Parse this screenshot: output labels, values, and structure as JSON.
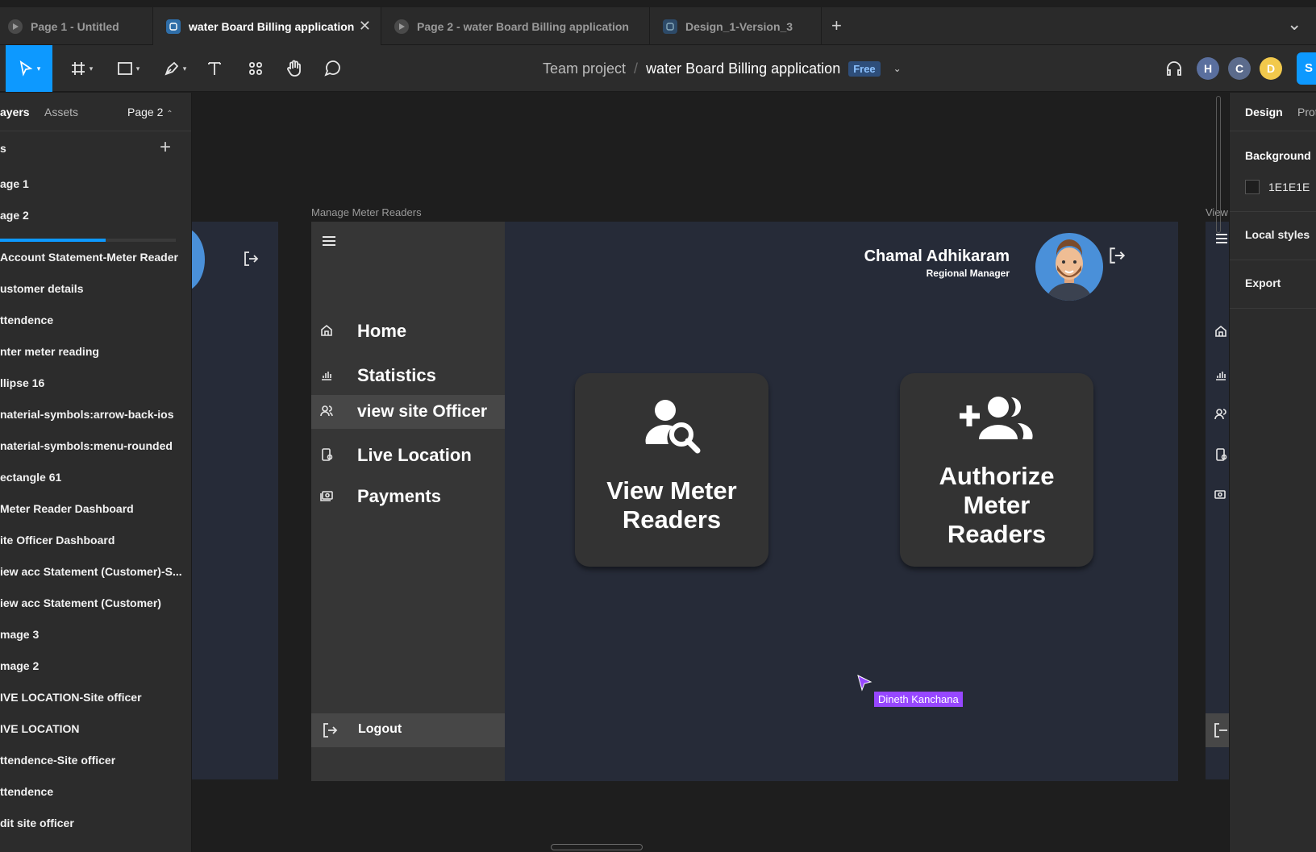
{
  "tabs": [
    {
      "label": "Page 1 - Untitled",
      "icon": "play-icon"
    },
    {
      "label": "water Board Billing application",
      "icon": "figma-file-icon",
      "active": true,
      "close": "✕"
    },
    {
      "label": "Page 2 - water Board Billing application",
      "icon": "play-icon"
    },
    {
      "label": "Design_1-Version_3",
      "icon": "figma-file-icon"
    }
  ],
  "tabbar": {
    "new_tab": "+",
    "menu": "⌄"
  },
  "breadcrumb": {
    "team": "Team project",
    "separator": "/",
    "file": "water Board Billing application",
    "badge": "Free"
  },
  "collaborators": [
    {
      "initial": "H",
      "color": "#5a6f9e"
    },
    {
      "initial": "C",
      "color": "#5b6b8c"
    },
    {
      "initial": "D",
      "color": "#f2c94c"
    }
  ],
  "share": {
    "label": "S"
  },
  "left_panel": {
    "tabs": {
      "layers": "ayers",
      "assets": "Assets",
      "page": "Page 2"
    },
    "pages_header": "s",
    "pages": [
      "age 1",
      "age 2"
    ],
    "layers": [
      "Account Statement-Meter Reader",
      "ustomer details",
      "ttendence",
      "nter meter reading",
      "llipse 16",
      "naterial-symbols:arrow-back-ios",
      "naterial-symbols:menu-rounded",
      "ectangle 61",
      "Meter Reader Dashboard",
      "ite Officer Dashboard",
      "iew acc Statement (Customer)-S...",
      "iew acc Statement (Customer)",
      "mage 3",
      "mage 2",
      "IVE LOCATION-Site officer",
      "IVE LOCATION",
      "ttendence-Site officer",
      "ttendence",
      "dit site officer"
    ]
  },
  "right_panel": {
    "tab_design": "Design",
    "tab_prototype": "Prot",
    "background_title": "Background",
    "background_value": "1E1E1E",
    "background_color": "#1e1e1e",
    "local_styles": "Local styles",
    "export": "Export"
  },
  "canvas": {
    "frame_label": "Manage Meter Readers",
    "right_frame_label": "View",
    "sidebar": {
      "nav": [
        {
          "label": "Home",
          "icon": "home-icon"
        },
        {
          "label": "Statistics",
          "icon": "bar-chart-icon"
        },
        {
          "label": "view site Officer",
          "icon": "people-icon",
          "active": true
        },
        {
          "label": "Live Location",
          "icon": "location-phone-icon"
        },
        {
          "label": "Payments",
          "icon": "payments-icon"
        }
      ],
      "logout": "Logout"
    },
    "profile": {
      "name": "Chamal Adhikaram",
      "role": "Regional Manager"
    },
    "cards": [
      {
        "lines": [
          "View Meter",
          "Readers"
        ],
        "icon": "person-search-icon"
      },
      {
        "lines": [
          "Authorize",
          "Meter",
          "Readers"
        ],
        "icon": "group-add-icon"
      }
    ],
    "cursor_user": "Dineth Kanchana",
    "colors": {
      "frame_bg": "#262b38",
      "sidebar_bg": "#363636",
      "card_bg": "#333333",
      "accent": "#0d99ff",
      "cursor": "#9747ff"
    }
  }
}
